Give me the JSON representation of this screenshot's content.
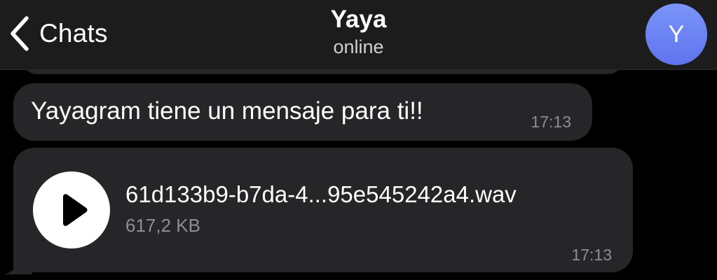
{
  "header": {
    "back_label": "Chats",
    "title": "Yaya",
    "status": "online",
    "avatar_initial": "Y",
    "avatar_color": "#6b84f3"
  },
  "messages": [
    {
      "type": "text",
      "text": "Yayagram tiene un mensaje para ti!!",
      "time": "17:13"
    },
    {
      "type": "audio-file",
      "file_name": "61d133b9-b7da-4...95e545242a4.wav",
      "file_size": "617,2 KB",
      "time": "17:13",
      "icon": "play-icon"
    }
  ],
  "colors": {
    "background": "#000000",
    "header": "#1c1c1d",
    "bubble": "#262628",
    "muted_text": "#8e8e93"
  }
}
